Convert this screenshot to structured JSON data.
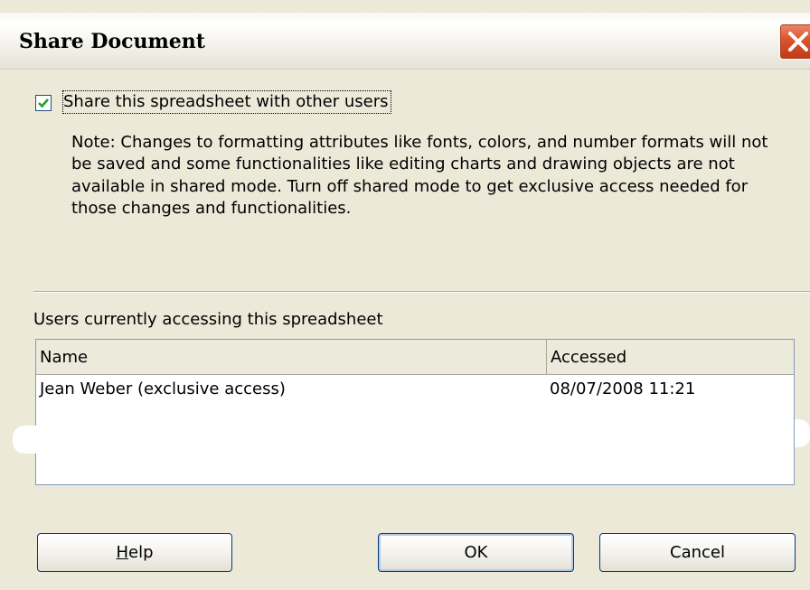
{
  "window": {
    "title": "Share Document",
    "close_icon": "close-icon"
  },
  "share": {
    "checkbox_checked": true,
    "checkbox_label": "Share this spreadsheet with other users",
    "note": "Note: Changes to formatting attributes like fonts, colors, and number formats will not be saved and some functionalities like editing charts and drawing objects are not available in shared mode. Turn off shared mode to get exclusive access needed for those changes and functionalities."
  },
  "users": {
    "label": "Users currently accessing this spreadsheet",
    "columns": [
      "Name",
      "Accessed"
    ],
    "rows": [
      {
        "name": "Jean Weber (exclusive access)",
        "accessed": "08/07/2008 11:21"
      }
    ]
  },
  "buttons": {
    "help": {
      "mnemonic": "H",
      "rest": "elp"
    },
    "ok": "OK",
    "cancel": "Cancel"
  },
  "colors": {
    "dialog_background": "#ece9d8",
    "close_button": "#d9532d",
    "checkmark": "#21a121",
    "list_border": "#7f9db9"
  }
}
